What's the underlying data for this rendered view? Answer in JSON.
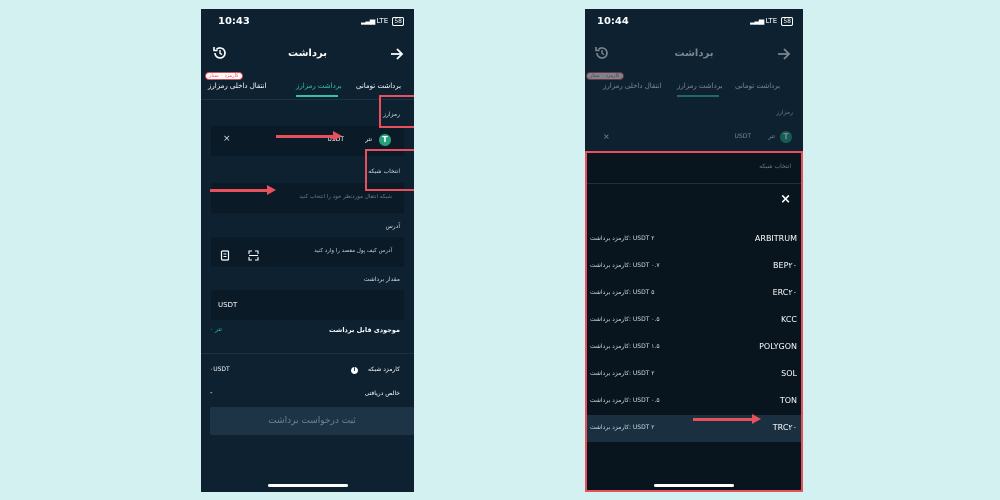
{
  "left": {
    "status": {
      "time": "10:43",
      "network": "LTE",
      "battery": "58"
    },
    "header": {
      "title": "برداشت",
      "history_icon": "history-icon",
      "back_icon": "arrow-right-icon"
    },
    "tabs": [
      {
        "label": "برداشت تومانی",
        "active": false
      },
      {
        "label": "برداشت رمزارز",
        "active": true
      },
      {
        "label": "انتقال داخلی رمزارز",
        "active": false,
        "badge": "کارمزد ۰ ستار"
      }
    ],
    "currency": {
      "label": "رمزارز",
      "name": "تتر",
      "symbol": "USDT",
      "clear": "×"
    },
    "network": {
      "label": "انتخاب شبکه",
      "placeholder": "شبکه انتقال موردنظر خود را انتخاب کنید"
    },
    "address": {
      "label": "آدرس",
      "placeholder": "آدرس کیف پول مقصد را وارد کنید"
    },
    "amount": {
      "label": "مقدار برداشت",
      "unit": "USDT"
    },
    "balance": {
      "label": "موجودی قابل برداشت",
      "value": "۰ تتر"
    },
    "fee": {
      "label": "کارمزد شبکه",
      "value": "۰USDT"
    },
    "net_received": {
      "label": "خالص دریافتی",
      "value": "-"
    },
    "submit_label": "ثبت درخواست برداشت"
  },
  "right": {
    "status": {
      "time": "10:44",
      "network": "LTE",
      "battery": "58"
    },
    "header": {
      "title": "برداشت"
    },
    "tabs": [
      {
        "label": "برداشت تومانی"
      },
      {
        "label": "برداشت رمزارز"
      },
      {
        "label": "انتقال داخلی رمزارز",
        "badge": "کارمزد ۰ ستار"
      }
    ],
    "currency": {
      "label": "رمزارز",
      "name": "تتر",
      "symbol": "USDT",
      "clear": "×"
    },
    "sheet": {
      "title": "انتخاب شبکه",
      "close": "×",
      "networks": [
        {
          "name": "ARBITRUM",
          "fee": "کارمزد برداشت: USDT ۲"
        },
        {
          "name": "BEP۲۰",
          "fee": "کارمزد برداشت: USDT ۰.۷"
        },
        {
          "name": "ERC۲۰",
          "fee": "کارمزد برداشت: USDT ۵"
        },
        {
          "name": "KCC",
          "fee": "کارمزد برداشت: USDT ۰.۵"
        },
        {
          "name": "POLYGON",
          "fee": "کارمزد برداشت: USDT ۱.۵"
        },
        {
          "name": "SOL",
          "fee": "کارمزد برداشت: USDT ۲"
        },
        {
          "name": "TON",
          "fee": "کارمزد برداشت: USDT ۰.۵"
        },
        {
          "name": "TRC۲۰",
          "fee": "کارمزد برداشت: USDT ۲"
        }
      ]
    }
  },
  "annotation_color": "#e8505b",
  "accent_color": "#39c2a2"
}
